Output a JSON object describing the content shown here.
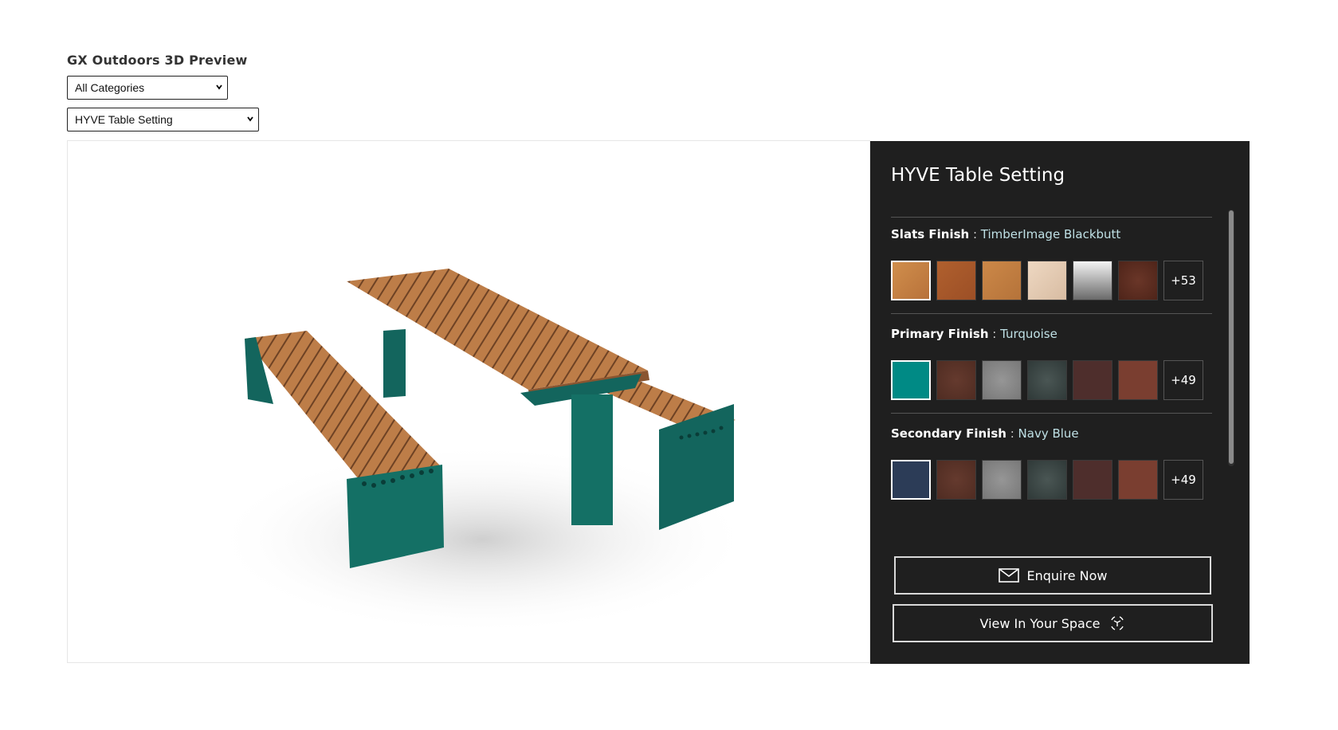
{
  "app": {
    "title": "GX Outdoors 3D Preview"
  },
  "filters": {
    "category": {
      "selected": "All Categories"
    },
    "product": {
      "selected": "HYVE Table Setting"
    }
  },
  "panel": {
    "title": "HYVE Table Setting",
    "finishes": [
      {
        "name": "Slats Finish",
        "separator": " : ",
        "value": "TimberImage Blackbutt",
        "swatches": [
          "#c9823f",
          "#a8582c",
          "#c27a3c",
          "#e3c9b0",
          "#9a9a9a",
          "#5e2e22"
        ],
        "more": "+53"
      },
      {
        "name": "Primary Finish",
        "separator": " : ",
        "value": "Turquoise",
        "swatches": [
          "#008a85",
          "#5b3328",
          "#858585",
          "#3d4847",
          "#4e2e2c",
          "#7a3e30"
        ],
        "more": "+49"
      },
      {
        "name": "Secondary Finish",
        "separator": " : ",
        "value": "Navy Blue",
        "swatches": [
          "#2c3c57",
          "#5b3328",
          "#858585",
          "#3d4847",
          "#4e2e2c",
          "#7a3e30"
        ],
        "more": "+49"
      }
    ],
    "buttons": {
      "enquire": "Enquire Now",
      "view_space": "View In Your Space"
    }
  },
  "colors": {
    "panel_bg": "#1f1f1f",
    "timber": "#b87845",
    "frame": "#0f5c55"
  }
}
